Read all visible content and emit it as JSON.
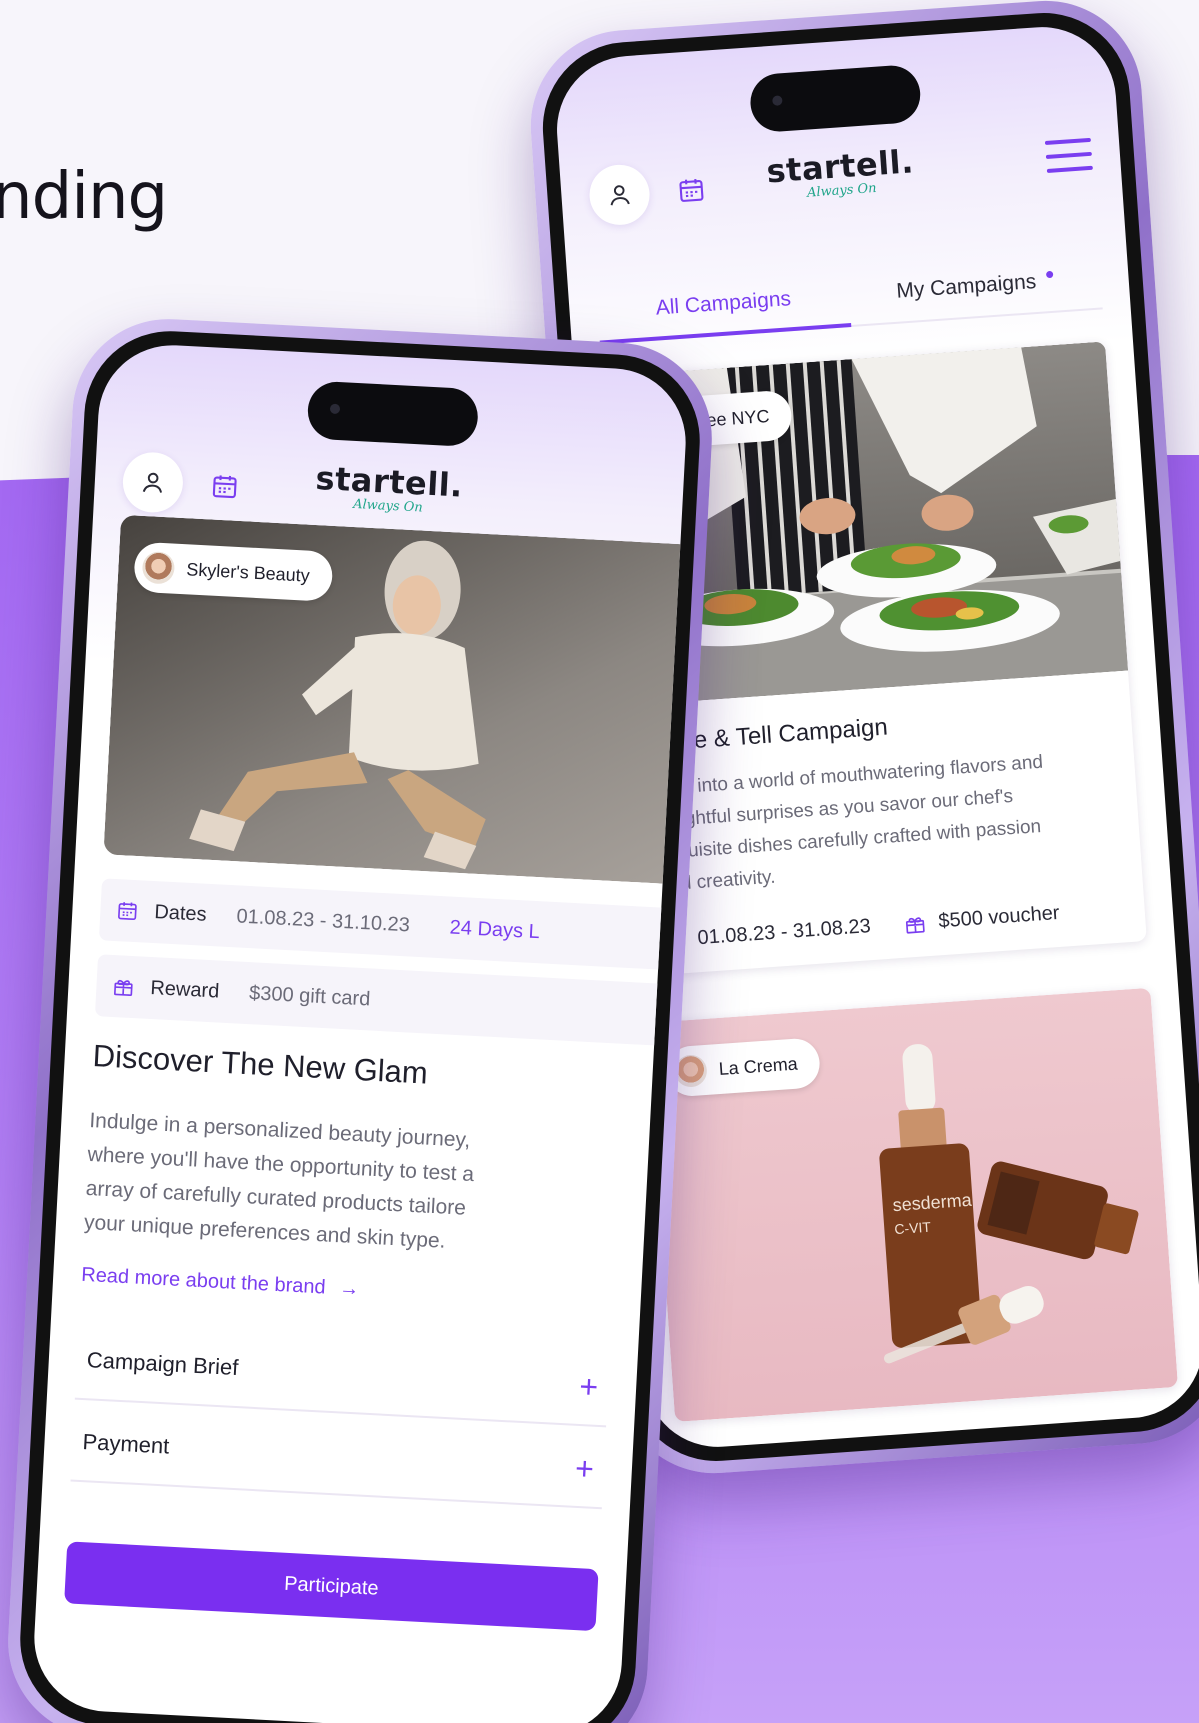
{
  "headline": "nding",
  "colors": {
    "accent": "#7a3ef0",
    "button": "#7a2ff0",
    "tagline": "#1fa58a"
  },
  "app": {
    "logo": "startell.",
    "tagline": "Always On"
  },
  "back_phone": {
    "tabs": [
      {
        "label": "All Campaigns",
        "active": true
      },
      {
        "label": "My Campaigns",
        "active": false,
        "dot": true
      }
    ],
    "cards": [
      {
        "brand": "Tastee NYC",
        "image": "chef plating salads",
        "title": "Taste & Tell Campaign",
        "description": "Step into a world of mouthwatering flavors and delightful surprises as you savor our chef's exquisite dishes carefully crafted with passion and creativity.",
        "description_lines": [
          "Step into a world of mouthwatering flavors and",
          "delightful surprises as you savor our chef's",
          "exquisite dishes carefully crafted with passion",
          "and creativity."
        ],
        "dates": "01.08.23 - 31.08.23",
        "reward": "$500 voucher"
      },
      {
        "brand": "La Crema",
        "image": "serum bottles on pink background"
      }
    ],
    "product_label": "sesderma",
    "product_sub": "C-VIT"
  },
  "front_phone": {
    "brand": "Skyler's Beauty",
    "image": "model in white sweater",
    "dates_label": "Dates",
    "dates_value": "01.08.23 - 31.10.23",
    "days_left": "24 Days L",
    "reward_label": "Reward",
    "reward_value": "$300 gift card",
    "title": "Discover The New Glam",
    "description_lines": [
      "Indulge in a personalized beauty journey,",
      "where you'll have the opportunity to test a",
      "array of carefully curated products tailore",
      "your unique preferences and skin type."
    ],
    "read_more": "Read more about the brand",
    "read_more_arrow": "→",
    "accordions": [
      {
        "label": "Campaign Brief",
        "icon": "+"
      },
      {
        "label": "Payment",
        "icon": "+"
      }
    ],
    "cta": "Participate"
  }
}
